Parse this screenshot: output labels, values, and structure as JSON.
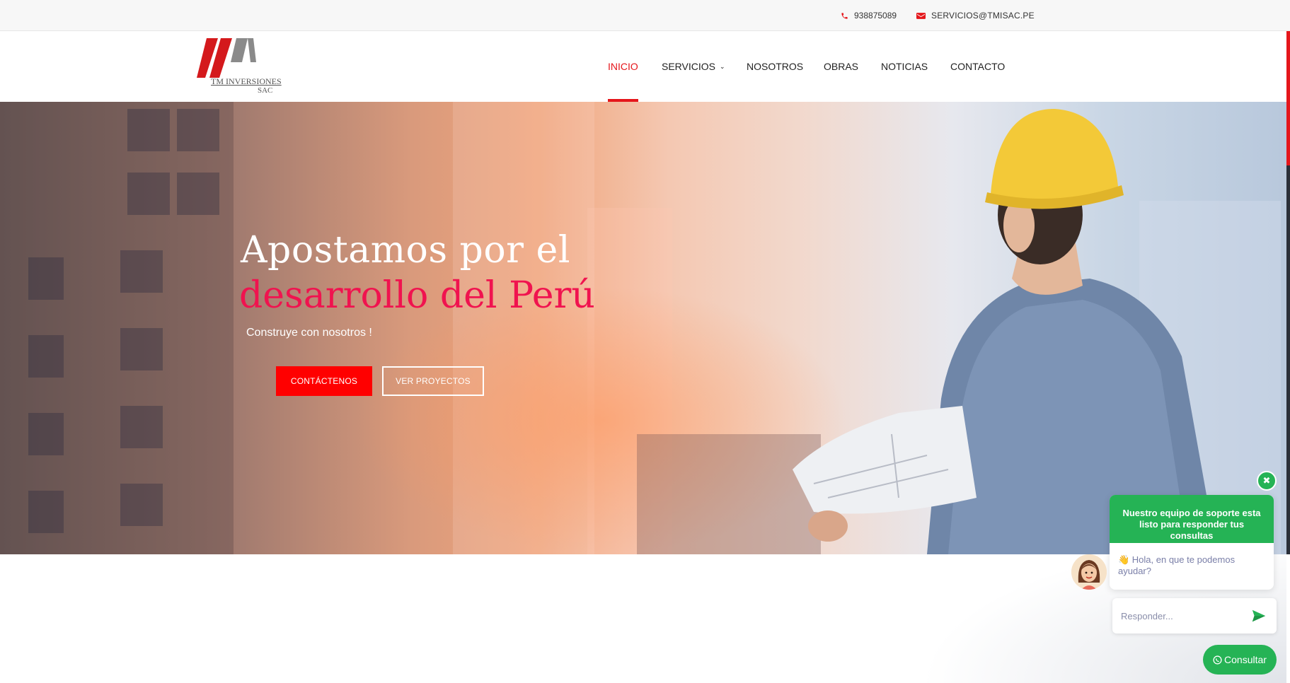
{
  "topbar": {
    "phone": "938875089",
    "email": "SERVICIOS@TMISAC.PE",
    "phone_icon": "phone-icon",
    "email_icon": "envelope-icon"
  },
  "logo": {
    "line1": "TM INVERSIONES",
    "line2": "SAC"
  },
  "nav": {
    "items": [
      {
        "label": "INICIO",
        "active": true
      },
      {
        "label": "SERVICIOS",
        "has_dropdown": true
      },
      {
        "label": "NOSOTROS"
      },
      {
        "label": "OBRAS"
      },
      {
        "label": "NOTICIAS"
      },
      {
        "label": "CONTACTO"
      }
    ]
  },
  "hero": {
    "title_line1": "Apostamos por el",
    "title_line2": "desarrollo del Perú",
    "subtitle": "Construye con nosotros !",
    "primary_button": "CONTÁCTENOS",
    "secondary_button": "VER PROYECTOS"
  },
  "chat": {
    "header": "Nuestro equipo de soporte esta listo para responder tus consultas",
    "greeting": "👋 Hola, en que te podemos ayudar?",
    "reply_placeholder": "Responder...",
    "consult_label": "Consultar"
  },
  "colors": {
    "accent": "#e5161b",
    "hero_title_accent": "#f0134f",
    "chat_green": "#25b355",
    "button_red": "#ff0000"
  }
}
